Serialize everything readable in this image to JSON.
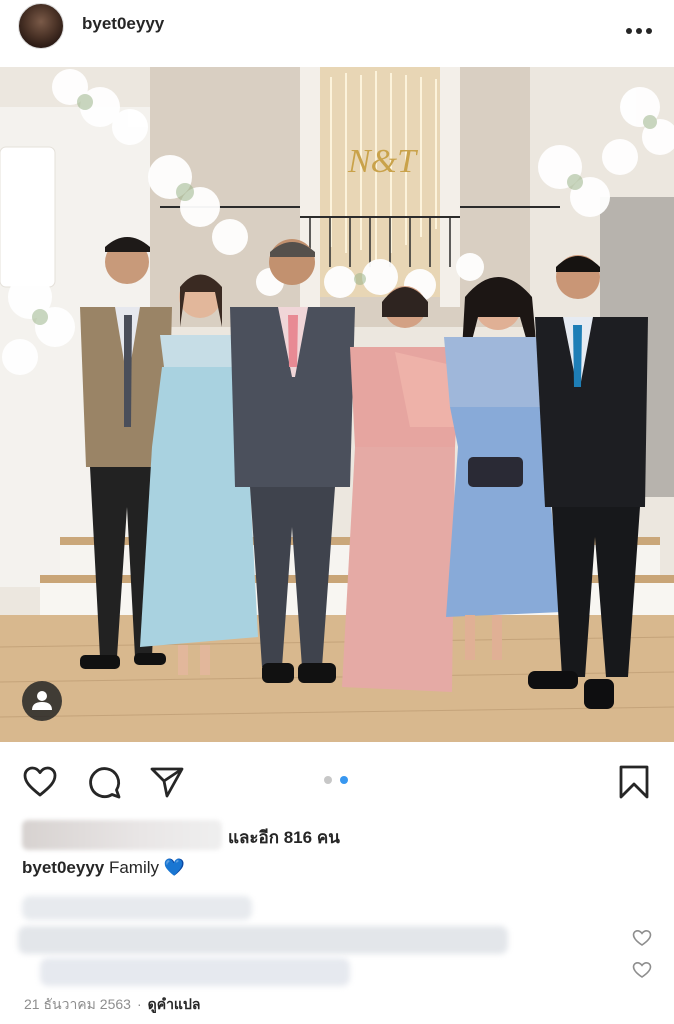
{
  "post": {
    "username": "byet0eyyy",
    "avatar_icon": "profile-avatar",
    "more_icon": "more-horizontal-icon"
  },
  "photo": {
    "monogram": "N&T",
    "tag_icon": "user-tag-icon"
  },
  "actions": {
    "like_icon": "heart-outline-icon",
    "comment_icon": "comment-icon",
    "share_icon": "send-icon",
    "save_icon": "bookmark-icon",
    "carousel": {
      "total": 2,
      "active": 2
    }
  },
  "likes": {
    "text": "และอีก 816 คน"
  },
  "caption": {
    "username": "byet0eyyy",
    "text": "Family",
    "emoji": "💙"
  },
  "comments": {
    "comment_like_icon": "heart-small-outline-icon"
  },
  "meta": {
    "date": "21 ธันวาคม 2563",
    "separator": "·",
    "translate": "ดูคำแปล"
  },
  "colors": {
    "accent": "#3897f0",
    "dot_inactive": "#c7c7c7",
    "text": "#262626",
    "muted": "#8e8e8e"
  }
}
